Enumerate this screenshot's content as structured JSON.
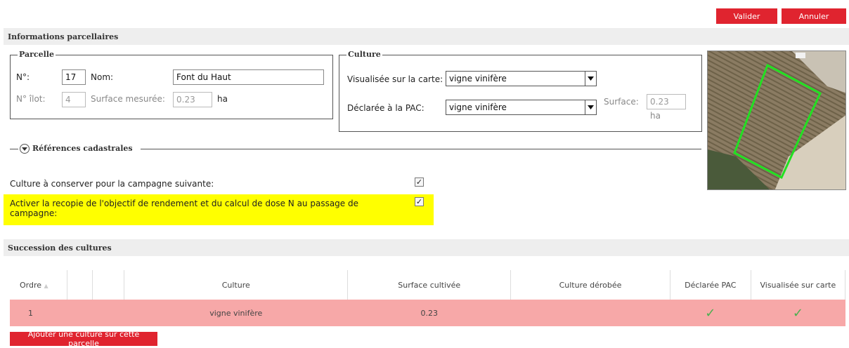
{
  "toolbar": {
    "validate_label": "Valider",
    "cancel_label": "Annuler"
  },
  "info_section": {
    "title": "Informations parcellaires"
  },
  "parcelle": {
    "legend": "Parcelle",
    "num_label": "N°:",
    "num_value": "17",
    "nom_label": "Nom:",
    "nom_value": "Font du Haut",
    "ilot_label": "N° îlot:",
    "ilot_value": "4",
    "surface_label": "Surface mesurée:",
    "surface_value": "0.23",
    "surface_unit": "ha"
  },
  "culture": {
    "legend": "Culture",
    "visualisee_label": "Visualisée sur la carte:",
    "visualisee_value": "vigne vinifère",
    "declaree_label": "Déclarée à la PAC:",
    "declaree_value": "vigne vinifère",
    "surface_label": "Surface:",
    "surface_value": "0.23",
    "surface_unit": "ha"
  },
  "cadastre": {
    "label": "Références cadastrales"
  },
  "options": {
    "conserver_label": "Culture à conserver pour la campagne suivante:",
    "conserver_checked": true,
    "recopie_label": "Activer la recopie de l'objectif de rendement et du calcul de dose N au passage de campagne:",
    "recopie_checked": true
  },
  "succession": {
    "title": "Succession des cultures",
    "columns": [
      "Ordre",
      "",
      "",
      "Culture",
      "Surface cultivée",
      "Culture dérobée",
      "Déclarée PAC",
      "Visualisée sur carte"
    ],
    "rows": [
      {
        "ordre": "1",
        "culture": "vigne vinifère",
        "surface": "0.23",
        "derobee": "",
        "declaree_pac": true,
        "visualisee": true
      }
    ],
    "add_button_label": "Ajouter une culture sur cette parcelle"
  },
  "icons": {
    "check": "checkmark-icon",
    "dropdown": "chevron-down-icon",
    "expand": "expand-circle-icon",
    "sort": "sort-asc-icon"
  },
  "colors": {
    "accent_red": "#e0242f",
    "row_highlight": "#f7a8a8",
    "note_highlight": "#ffff00",
    "check_green": "#4caf50"
  }
}
